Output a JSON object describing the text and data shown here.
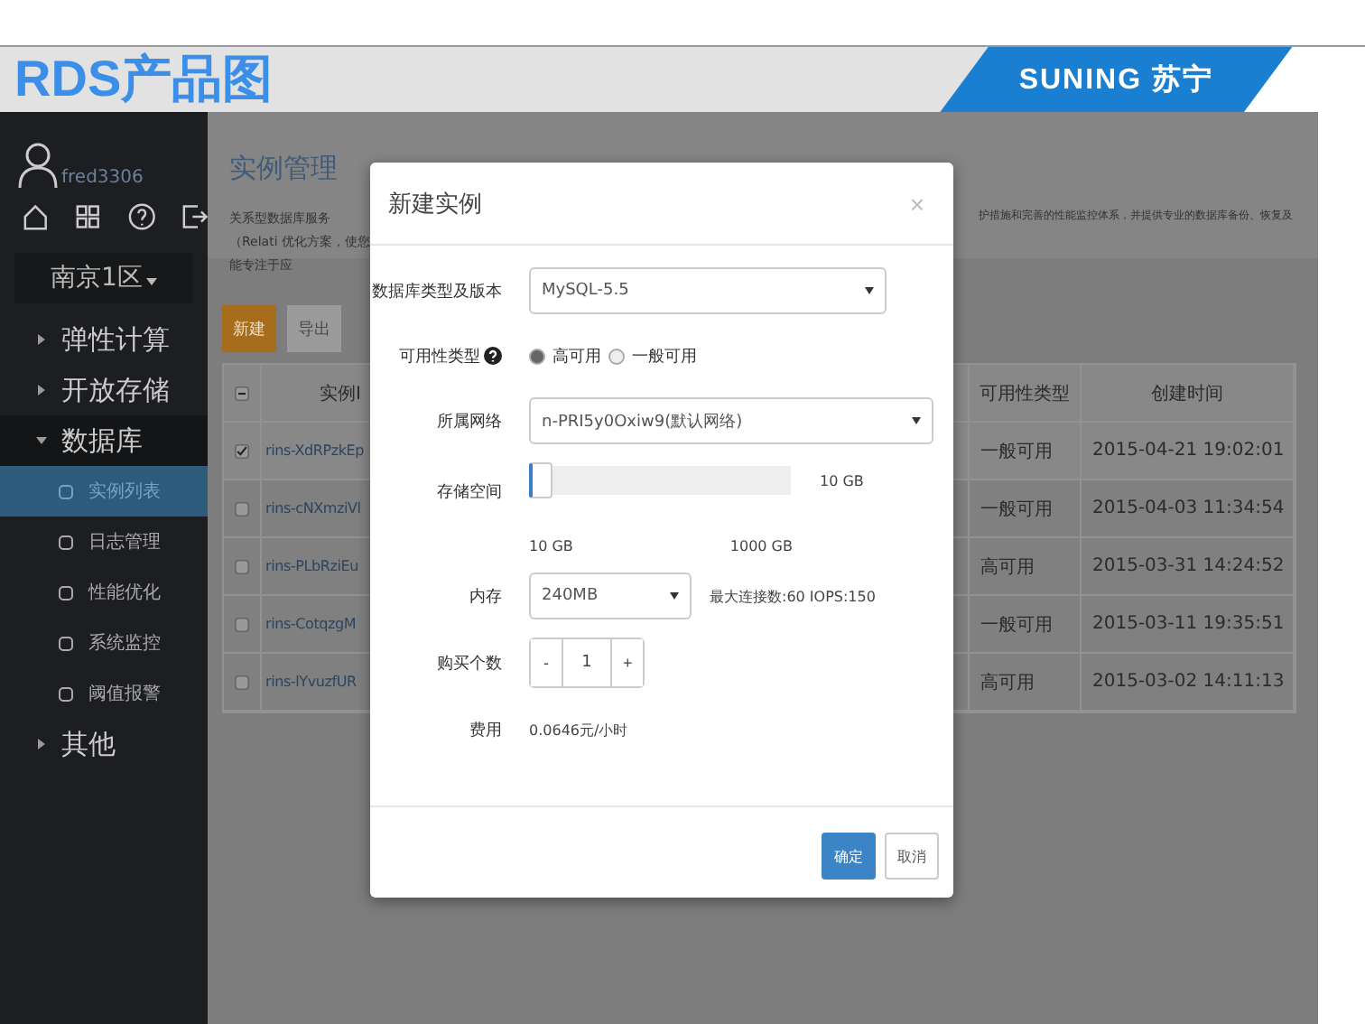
{
  "slide": {
    "title": "RDS产品图",
    "logo": "SUNING 苏宁"
  },
  "sidebar": {
    "user": "fred3306",
    "region": "南京1区",
    "menu": [
      {
        "label": "弹性计算",
        "expanded": false
      },
      {
        "label": "开放存储",
        "expanded": false
      },
      {
        "label": "数据库",
        "expanded": true,
        "children": [
          {
            "label": "实例列表",
            "selected": true
          },
          {
            "label": "日志管理",
            "selected": false
          },
          {
            "label": "性能优化",
            "selected": false
          },
          {
            "label": "系统监控",
            "selected": false
          },
          {
            "label": "阈值报警",
            "selected": false
          }
        ]
      },
      {
        "label": "其他",
        "expanded": false
      }
    ]
  },
  "page": {
    "title": "实例管理",
    "description_left": "关系型数据库服务（Relati 优化方案，使您能专注于应",
    "description_right": "护措施和完善的性能监控体系，并提供专业的数据库备份、恢复及",
    "toolbar": [
      {
        "label": "新建",
        "disabled": false
      },
      {
        "label": "导出",
        "disabled": true
      }
    ],
    "table": {
      "header_partial": true,
      "columns": [
        "实例I",
        "可用性类型",
        "创建时间"
      ],
      "rows": [
        {
          "checked": true,
          "id": "rins-XdRPzkEp",
          "availability": "一般可用",
          "created": "2015-04-21 19:02:01"
        },
        {
          "checked": false,
          "id": "rins-cNXmziVl",
          "availability": "一般可用",
          "created": "2015-04-03 11:34:54"
        },
        {
          "checked": false,
          "id": "rins-PLbRziEu",
          "availability": "高可用",
          "created": "2015-03-31 14:24:52"
        },
        {
          "checked": false,
          "id": "rins-CotqzgM",
          "availability": "一般可用",
          "created": "2015-03-11 19:35:51"
        },
        {
          "checked": false,
          "id": "rins-lYvuzfUR",
          "availability": "高可用",
          "created": "2015-03-02 14:11:13"
        }
      ]
    }
  },
  "modal": {
    "title": "新建实例",
    "close": "×",
    "fields": [
      {
        "kind": "select",
        "label": "数据库类型及版本",
        "value": "MySQL-5.5"
      },
      {
        "kind": "radio",
        "label": "可用性类型",
        "help": true,
        "options": [
          {
            "label": "高可用",
            "selected": true
          },
          {
            "label": "一般可用",
            "selected": false
          }
        ]
      },
      {
        "kind": "select",
        "label": "所属网络",
        "value": "n-PRI5y0Oxiw9(默认网络)"
      },
      {
        "kind": "slider",
        "label": "存储空间",
        "level": 0,
        "reading": "10 GB",
        "min": "10 GB",
        "max": "1000 GB"
      },
      {
        "kind": "select",
        "label": "内存",
        "value": "240MB",
        "note": "最大连接数:60 IOPS:150"
      },
      {
        "kind": "stepper",
        "label": "购买个数",
        "minus": "-",
        "value": "1",
        "plus": "+"
      },
      {
        "kind": "text",
        "label": "费用",
        "value": "0.0646元/小时"
      }
    ],
    "buttons": [
      {
        "label": "确定",
        "primary": true
      },
      {
        "label": "取消",
        "primary": false
      }
    ]
  }
}
